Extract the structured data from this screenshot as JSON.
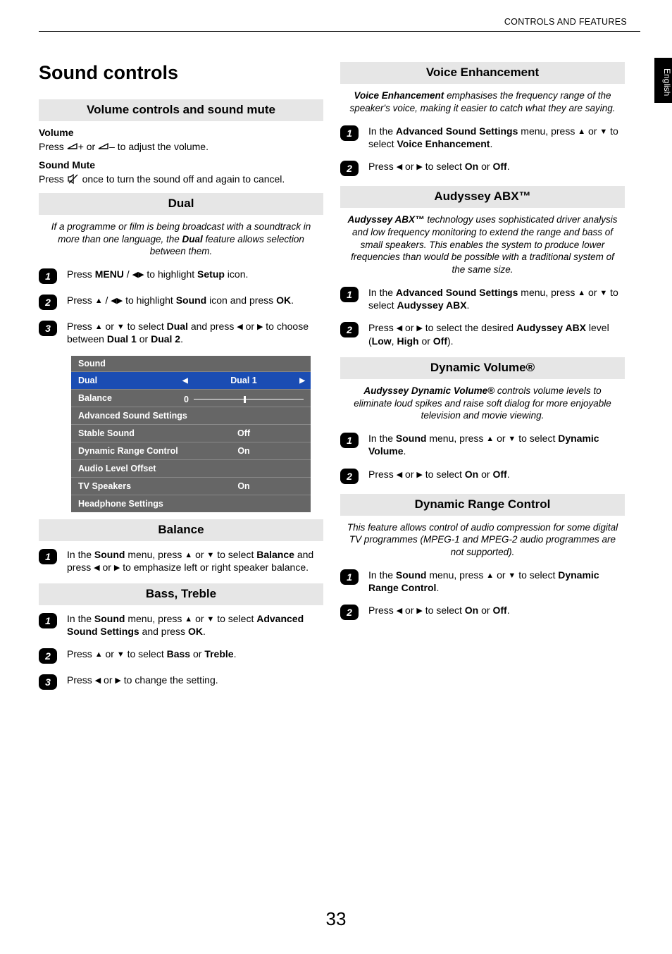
{
  "running_head": "CONTROLS AND FEATURES",
  "lang_tab": "English",
  "page_number": "33",
  "left": {
    "title": "Sound controls",
    "volume_section": {
      "heading": "Volume controls and sound mute",
      "vol_label": "Volume",
      "vol_text_pre": "Press ",
      "vol_text_post": " to adjust the volume.",
      "vol_plus_minus": "+ or −",
      "mute_label": "Sound Mute",
      "mute_text_pre": "Press ",
      "mute_text_post": " once to turn the sound off and again to cancel."
    },
    "dual": {
      "heading": "Dual",
      "intro": "If a programme or film is being broadcast with a soundtrack in more than one language, the Dual feature allows selection between them.",
      "steps": [
        {
          "n": "1",
          "pre": "Press ",
          "b1": "MENU",
          "mid": " / ",
          "post": " to highlight ",
          "b2": "Setup",
          "post2": " icon."
        },
        {
          "n": "2",
          "pre": "Press ",
          "mid": " / ",
          "post": " to highlight ",
          "b1": "Sound",
          "post2": " icon and press ",
          "b2": "OK",
          "post3": "."
        },
        {
          "n": "3",
          "pre": "Press ",
          "mid": " or ",
          "post": " to select ",
          "b1": "Dual",
          "post2": " and press ",
          "mid2": " or ",
          "post3": " to choose between ",
          "b2": "Dual 1",
          "post4": " or ",
          "b3": "Dual 2",
          "post5": "."
        }
      ]
    },
    "osd": {
      "title": "Sound",
      "rows": [
        {
          "label": "Dual",
          "value": "Dual 1",
          "selected": true,
          "arrows": true
        },
        {
          "label": "Balance",
          "value": "",
          "slider": true,
          "zero": "0"
        },
        {
          "label": "Advanced Sound Settings",
          "value": ""
        },
        {
          "label": "Stable Sound",
          "value": "Off"
        },
        {
          "label": "Dynamic Range Control",
          "value": "On"
        },
        {
          "label": "Audio Level Offset",
          "value": ""
        },
        {
          "label": "TV Speakers",
          "value": "On"
        },
        {
          "label": "Headphone Settings",
          "value": ""
        }
      ]
    },
    "balance": {
      "heading": "Balance",
      "step": {
        "n": "1",
        "pre": "In the ",
        "b1": "Sound",
        "mid": " menu, press ",
        "mid2": " or ",
        "post": " to select ",
        "b2": "Balance",
        "post2": " and press ",
        "mid3": " or ",
        "post3": " to emphasize left or right speaker balance."
      }
    },
    "bass": {
      "heading": "Bass, Treble",
      "steps": [
        {
          "n": "1",
          "pre": "In the ",
          "b1": "Sound",
          "mid": " menu, press ",
          "mid2": " or ",
          "post": " to select ",
          "b2": "Advanced Sound Settings",
          "post2": " and press ",
          "b3": "OK",
          "post3": "."
        },
        {
          "n": "2",
          "pre": "Press ",
          "mid": " or ",
          "post": " to select ",
          "b1": "Bass",
          "post2": " or ",
          "b2": "Treble",
          "post3": "."
        },
        {
          "n": "3",
          "pre": "Press ",
          "mid": " or ",
          "post": " to change the setting."
        }
      ]
    }
  },
  "right": {
    "voice": {
      "heading": "Voice Enhancement",
      "intro_b": "Voice Enhancement",
      "intro": " emphasises the frequency range of the speaker's voice, making it easier to catch what they are saying.",
      "steps": [
        {
          "n": "1",
          "pre": "In the ",
          "b1": "Advanced Sound Settings",
          "mid": " menu, press ",
          "mid2": " or ",
          "post": " to select ",
          "b2": "Voice Enhancement",
          "post2": "."
        },
        {
          "n": "2",
          "pre": "Press ",
          "mid": " or ",
          "post": " to select ",
          "b1": "On",
          "post2": " or ",
          "b2": "Off",
          "post3": "."
        }
      ]
    },
    "abx": {
      "heading": "Audyssey ABX™",
      "intro_b": "Audyssey ABX™",
      "intro": " technology uses sophisticated driver analysis and low frequency monitoring to extend the range and bass of small speakers. This enables the system to produce lower frequencies than would be possible with a traditional system of the same size.",
      "steps": [
        {
          "n": "1",
          "pre": "In the ",
          "b1": "Advanced Sound Settings",
          "mid": " menu, press ",
          "mid2": " or ",
          "post": " to select ",
          "b2": "Audyssey ABX",
          "post2": "."
        },
        {
          "n": "2",
          "pre": "Press ",
          "mid": " or ",
          "post": " to select the desired ",
          "b1": "Audyssey ABX",
          "post2": " level (",
          "b2": "Low",
          "post3": ", ",
          "b3": "High",
          "post4": " or ",
          "b4": "Off",
          "post5": ")."
        }
      ]
    },
    "dynvol": {
      "heading": "Dynamic Volume®",
      "intro_b": "Audyssey Dynamic Volume®",
      "intro": " controls volume levels to eliminate loud spikes and raise soft dialog for more enjoyable television and movie viewing.",
      "steps": [
        {
          "n": "1",
          "pre": "In the ",
          "b1": "Sound",
          "mid": " menu, press ",
          "mid2": " or ",
          "post": " to select ",
          "b2": "Dynamic Volume",
          "post2": "."
        },
        {
          "n": "2",
          "pre": "Press ",
          "mid": " or ",
          "post": " to select ",
          "b1": "On",
          "post2": " or ",
          "b2": "Off",
          "post3": "."
        }
      ]
    },
    "drc": {
      "heading": "Dynamic Range Control",
      "intro": "This feature allows control of audio compression for some digital TV programmes (MPEG-1 and MPEG-2 audio programmes are not supported).",
      "steps": [
        {
          "n": "1",
          "pre": "In the ",
          "b1": "Sound",
          "mid": " menu, press ",
          "mid2": " or ",
          "post": " to select ",
          "b2": "Dynamic Range Control",
          "post2": "."
        },
        {
          "n": "2",
          "pre": "Press ",
          "mid": " or ",
          "post": " to select ",
          "b1": "On",
          "post2": " or ",
          "b2": "Off",
          "post3": "."
        }
      ]
    }
  }
}
